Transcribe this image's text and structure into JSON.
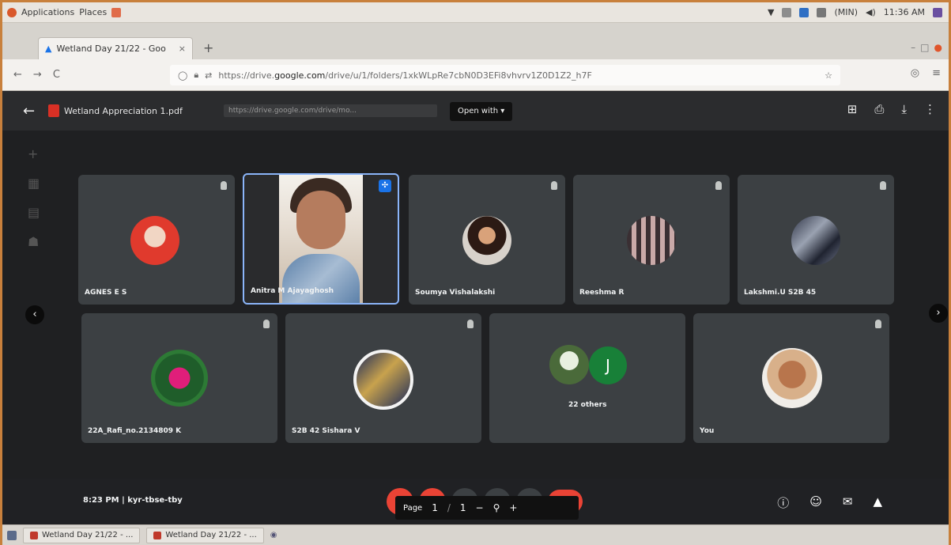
{
  "system_bar": {
    "menu_applications": "Applications",
    "menu_places": "Places",
    "time": "11:36 AM",
    "user": "(MIN)"
  },
  "browser": {
    "tab_title": "Wetland Day 21/22 - Goo",
    "address": {
      "prefix": "https://drive.",
      "domain": "google.com",
      "suffix": "/drive/u/1/folders/1xkWLpRe7cbN0D3EFi8vhvrv1Z0D1Z2_h7F"
    }
  },
  "meet": {
    "pdf_file_name": "Wetland Appreciation 1.pdf",
    "ghost_url": "https://drive.google.com/drive/mo...",
    "open_with_label": "Open with ▾",
    "participants": [
      {
        "name": "AGNES E S"
      },
      {
        "name": "Anitra M Ajayaghosh"
      },
      {
        "name": "Soumya Vishalakshi"
      },
      {
        "name": "Reeshma R"
      },
      {
        "name": "Lakshmi.U S2B 45"
      },
      {
        "name": "22A_Rafi_no.2134809 K"
      },
      {
        "name": "S2B 42 Sishara V"
      },
      {
        "name": "22 others"
      },
      {
        "name": "You"
      }
    ],
    "others_avatar_letter": "J",
    "meeting_info": "8:23 PM  |  kyr-tbse-tby",
    "pdf_toolbar": {
      "page_label": "Page",
      "page_current": "1",
      "page_total": "1",
      "zoom_out": "−",
      "zoom_icon": "⚲",
      "zoom_in": "+"
    }
  },
  "taskbar": {
    "task_1": "Wetland Day 21/22 - ...",
    "task_2": "Wetland Day 21/22 - ..."
  },
  "colors": {
    "meet_bg": "#1f2022",
    "tile_bg": "#3c4043",
    "active_border": "#8ab4f8",
    "end_call_red": "#ea4335",
    "frame_border": "#c8803c"
  }
}
